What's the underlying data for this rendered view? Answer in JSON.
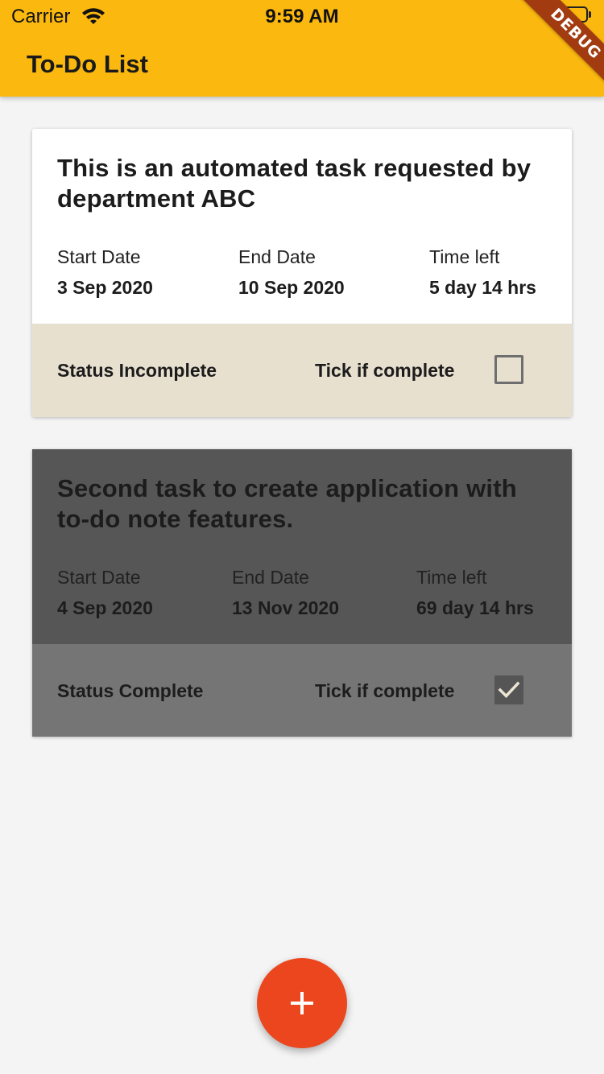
{
  "status_bar": {
    "carrier": "Carrier",
    "time": "9:59 AM",
    "battery_level": 0.2
  },
  "app_bar": {
    "title": "To-Do List",
    "debug_banner": "DEBUG",
    "color": "#fbb80f"
  },
  "tasks": [
    {
      "title": "This is an automated task requested by department ABC",
      "start_label": "Start Date",
      "start_value": "3 Sep 2020",
      "end_label": "End Date",
      "end_value": "10 Sep 2020",
      "time_label": "Time left",
      "time_value": "5 day 14 hrs",
      "status": "Status Incomplete",
      "tick_label": "Tick if complete",
      "completed": false
    },
    {
      "title": "Second task to create application with to-do note features.",
      "start_label": "Start Date",
      "start_value": "4 Sep 2020",
      "end_label": "End Date",
      "end_value": "13 Nov 2020",
      "time_label": "Time left",
      "time_value": "69 day 14 hrs",
      "status": "Status Complete",
      "tick_label": "Tick if complete",
      "completed": true
    }
  ],
  "fab": {
    "icon": "plus-icon",
    "color": "#eb461d"
  }
}
